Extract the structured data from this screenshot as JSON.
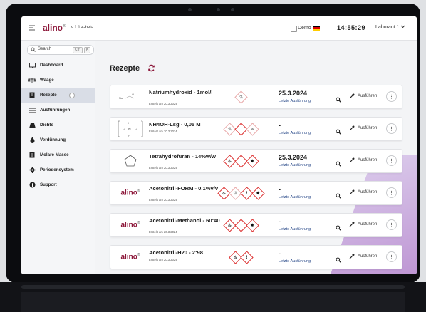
{
  "header": {
    "logo": "alino",
    "logo_mark": "®",
    "version": "v.1.1.4-beta",
    "demo_label": "Demo",
    "time": "14:55:29",
    "user": "Laborant 1"
  },
  "sidebar": {
    "search_label": "Search",
    "shortcut_keys": [
      "Ctrl",
      "K"
    ],
    "items": [
      {
        "label": "Dashboard",
        "icon": "monitor-icon"
      },
      {
        "label": "Waage",
        "icon": "scale-icon"
      },
      {
        "label": "Rezepte",
        "icon": "recipe-icon",
        "active": true
      },
      {
        "label": "Ausführungen",
        "icon": "list-icon"
      },
      {
        "label": "Dichte",
        "icon": "weight-icon"
      },
      {
        "label": "Verdünnung",
        "icon": "drop-icon"
      },
      {
        "label": "Molare Masse",
        "icon": "document-icon"
      },
      {
        "label": "Periodensystem",
        "icon": "gear-icon"
      },
      {
        "label": "Support",
        "icon": "info-icon"
      }
    ]
  },
  "main": {
    "title": "Rezepte",
    "run_label": "Ausführen",
    "last_run_label": "Letzte Ausführung",
    "recipes": [
      {
        "name": "Natriumhydroxid - 1mol/l",
        "created": "Erstellt am 20.3.2024",
        "date": "25.3.2024",
        "structure": "naoh",
        "ghs": [
          "corrosive"
        ]
      },
      {
        "name": "NH4OH-Lsg - 0,05 M",
        "created": "Erstellt am 20.3.2024",
        "date": "-",
        "structure": "nh4oh",
        "ghs": [
          "corrosive",
          "exclamation",
          "environment"
        ]
      },
      {
        "name": "Tetrahydrofuran - 14%w/w",
        "created": "Erstellt am 20.3.2024",
        "date": "25.3.2024",
        "structure": "thf",
        "ghs": [
          "flame",
          "exclamation",
          "health-hazard"
        ]
      },
      {
        "name": "Acetonitril-FORM - 0.1%v/v",
        "created": "Erstellt am 20.3.2024",
        "date": "-",
        "structure": "alino",
        "ghs": [
          "flame",
          "corrosive",
          "exclamation",
          "health-hazard"
        ]
      },
      {
        "name": "Acetonitril-Methanol - 60:40",
        "created": "Erstellt am 20.3.2024",
        "date": "-",
        "structure": "alino",
        "ghs": [
          "flame",
          "exclamation",
          "health-hazard"
        ]
      },
      {
        "name": "Acetonitril-H20 - 2:98",
        "created": "Erstellt am 20.3.2024",
        "date": "-",
        "structure": "alino",
        "ghs": [
          "flame",
          "exclamation"
        ]
      }
    ]
  },
  "colors": {
    "brand": "#8b1538",
    "ghs_red": "#dd3333",
    "link_blue": "#2d4d8b"
  }
}
